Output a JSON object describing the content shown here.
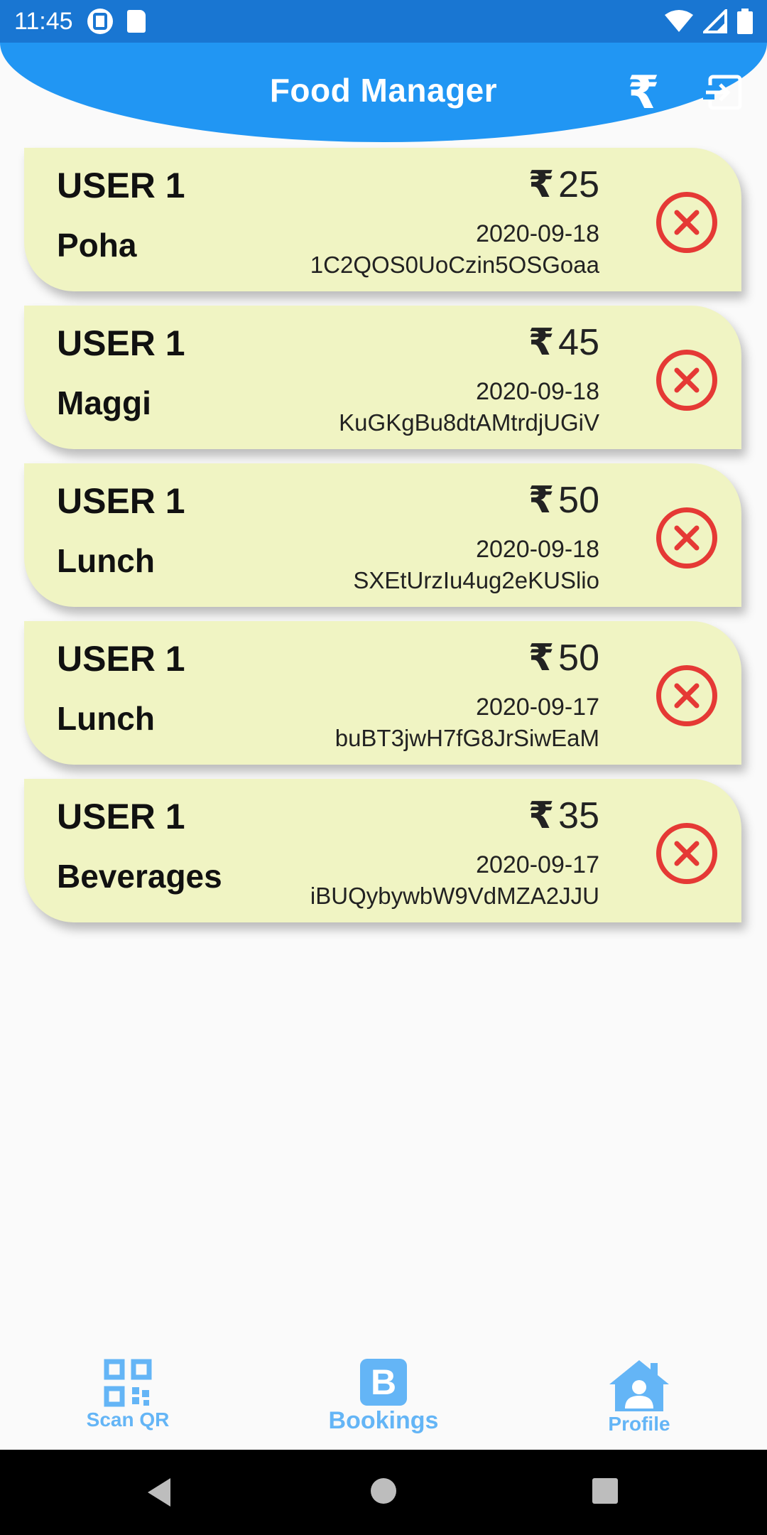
{
  "status_bar": {
    "time": "11:45"
  },
  "app_bar": {
    "title": "Food Manager",
    "rupee_symbol": "₹"
  },
  "bookings": [
    {
      "user": "USER 1",
      "item": "Poha",
      "currency": "₹",
      "price": "25",
      "date": "2020-09-18",
      "code": "1C2QOS0UoCzin5OSGoaa"
    },
    {
      "user": "USER 1",
      "item": "Maggi",
      "currency": "₹",
      "price": "45",
      "date": "2020-09-18",
      "code": "KuGKgBu8dtAMtrdjUGiV"
    },
    {
      "user": "USER 1",
      "item": "Lunch",
      "currency": "₹",
      "price": "50",
      "date": "2020-09-18",
      "code": "SXEtUrzIu4ug2eKUSlio"
    },
    {
      "user": "USER 1",
      "item": "Lunch",
      "currency": "₹",
      "price": "50",
      "date": "2020-09-17",
      "code": "buBT3jwH7fG8JrSiwEaM"
    },
    {
      "user": "USER 1",
      "item": "Beverages",
      "currency": "₹",
      "price": "35",
      "date": "2020-09-17",
      "code": "iBUQybywbW9VdMZA2JJU"
    }
  ],
  "bottom_nav": {
    "scan_label": "Scan QR",
    "bookings_label": "Bookings",
    "bookings_icon_letter": "B",
    "profile_label": "Profile"
  },
  "colors": {
    "status_bar": "#1976d2",
    "app_bar": "#2196f3",
    "card": "#f0f4c3",
    "cancel": "#e53935",
    "nav": "#64b5f6"
  }
}
